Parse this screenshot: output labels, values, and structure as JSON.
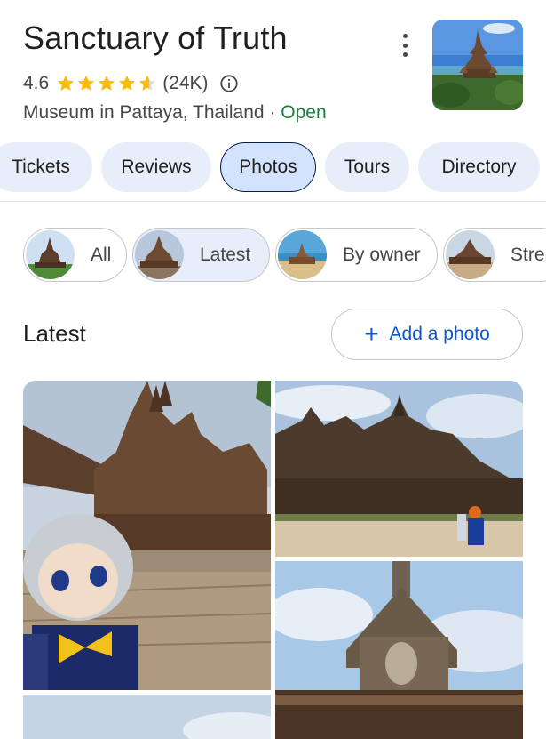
{
  "place": {
    "title": "Sanctuary of Truth",
    "rating": "4.6",
    "review_count": "(24K)",
    "category": "Museum in Pattaya, Thailand",
    "separator": " · ",
    "status": "Open",
    "stars_value": 4.6
  },
  "tabs": [
    {
      "label": "Tickets",
      "active": false
    },
    {
      "label": "Reviews",
      "active": false
    },
    {
      "label": "Photos",
      "active": true
    },
    {
      "label": "Tours",
      "active": false
    },
    {
      "label": "Directory",
      "active": false
    }
  ],
  "chips": [
    {
      "label": "All",
      "selected": false
    },
    {
      "label": "Latest",
      "selected": true
    },
    {
      "label": "By owner",
      "selected": false
    },
    {
      "label": "Stre",
      "selected": false
    }
  ],
  "section": {
    "title": "Latest",
    "add_photo_label": "Add a photo"
  },
  "colors": {
    "accent_blue": "#0b57d0",
    "open_green": "#188038",
    "star_gold": "#fbbc04",
    "chip_selected_bg": "#e8eef9"
  },
  "icons": {
    "more": "more-vert-icon",
    "info": "info-icon",
    "add": "plus-icon",
    "star": "star-icon"
  }
}
